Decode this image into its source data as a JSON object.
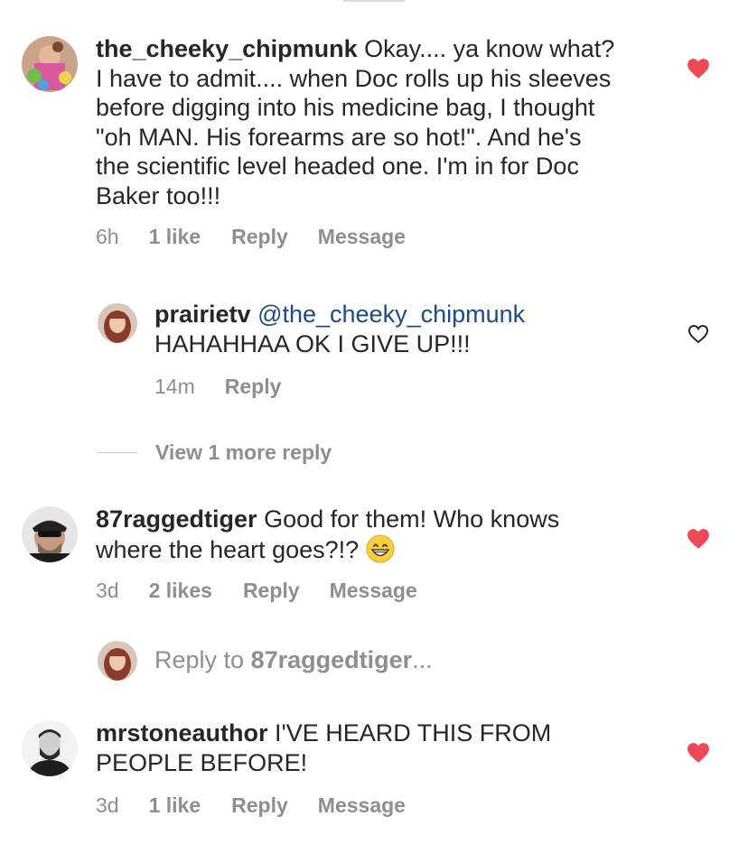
{
  "comments": [
    {
      "username": "the_cheeky_chipmunk",
      "lines": [
        "Okay.... ya know what?",
        "I have to admit.... when Doc rolls up his sleeves",
        "before digging into his medicine bag, I thought",
        "\"oh MAN.  His forearms are so hot!\". And he's",
        "the scientific level headed one.  I'm in for Doc",
        "Baker too!!!"
      ],
      "time": "6h",
      "likes": "1 like",
      "reply": "Reply",
      "message": "Message",
      "liked": true,
      "heart_color": "#ed4956"
    },
    {
      "username": "87raggedtiger",
      "lines": [
        "Good for them! Who knows",
        "where the heart goes?!?"
      ],
      "emoji": "grinning-face",
      "time": "3d",
      "likes": "2 likes",
      "reply": "Reply",
      "message": "Message",
      "liked": true
    },
    {
      "username": "mrstoneauthor",
      "lines": [
        "I'VE HEARD THIS FROM",
        "PEOPLE BEFORE!"
      ],
      "time": "3d",
      "likes": "1 like",
      "reply": "Reply",
      "message": "Message",
      "liked": true
    }
  ],
  "reply": {
    "username": "prairietv",
    "mention": "@the_cheeky_chipmunk",
    "text": "HAHAHHAA OK I GIVE UP!!!",
    "time": "14m",
    "reply": "Reply",
    "liked": false
  },
  "view_more": "View 1 more reply",
  "reply_to": {
    "prefix": "Reply to ",
    "user": "87raggedtiger",
    "suffix": "..."
  },
  "colors": {
    "heart": "#ed4956",
    "meta": "#8e8e8e",
    "mention": "#1c4b7f"
  }
}
